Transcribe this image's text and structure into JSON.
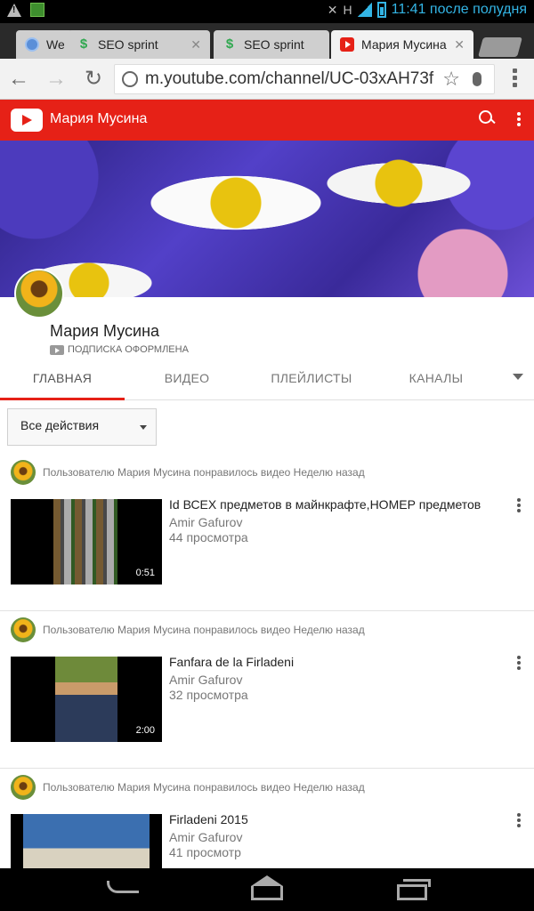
{
  "status_bar": {
    "time": "11:41 после полудня",
    "network": "H"
  },
  "tabs": [
    {
      "title": "We",
      "icon": "globe-icon",
      "active": false
    },
    {
      "title": "SEO sprint",
      "icon": "seo-sprint-icon",
      "active": false
    },
    {
      "title": "SEO sprint",
      "icon": "seo-sprint-icon",
      "active": false
    },
    {
      "title": "Мария Мусина",
      "icon": "youtube-icon",
      "active": true
    }
  ],
  "toolbar": {
    "url": "m.youtube.com/channel/UC-03xAH73f"
  },
  "yt_header": {
    "title": "Мария Мусина"
  },
  "channel": {
    "name": "Мария Мусина",
    "subscription_status": "ПОДПИСКА ОФОРМЛЕНА",
    "tabs": [
      "ГЛАВНАЯ",
      "ВИДЕО",
      "ПЛЕЙЛИСТЫ",
      "КАНАЛЫ"
    ],
    "active_tab": "ГЛАВНАЯ"
  },
  "filter": {
    "selected": "Все действия"
  },
  "feed": [
    {
      "activity": "Пользователю Мария Мусина понравилось видео Неделю назад",
      "title": "Id ВСЕХ предметов в майнкрафте,НОМЕР предметов",
      "channel": "Amir Gafurov",
      "views": "44 просмотра",
      "duration": "0:51"
    },
    {
      "activity": "Пользователю Мария Мусина понравилось видео Неделю назад",
      "title": "Fanfara de la Firladeni",
      "channel": "Amir Gafurov",
      "views": "32 просмотра",
      "duration": "2:00"
    },
    {
      "activity": "Пользователю Мария Мусина понравилось видео Неделю назад",
      "title": "Firladeni 2015",
      "channel": "Amir Gafurov",
      "views": "41 просмотр",
      "duration": ""
    }
  ],
  "colors": {
    "youtube_red": "#e62117",
    "status_blue": "#33b5e5"
  }
}
